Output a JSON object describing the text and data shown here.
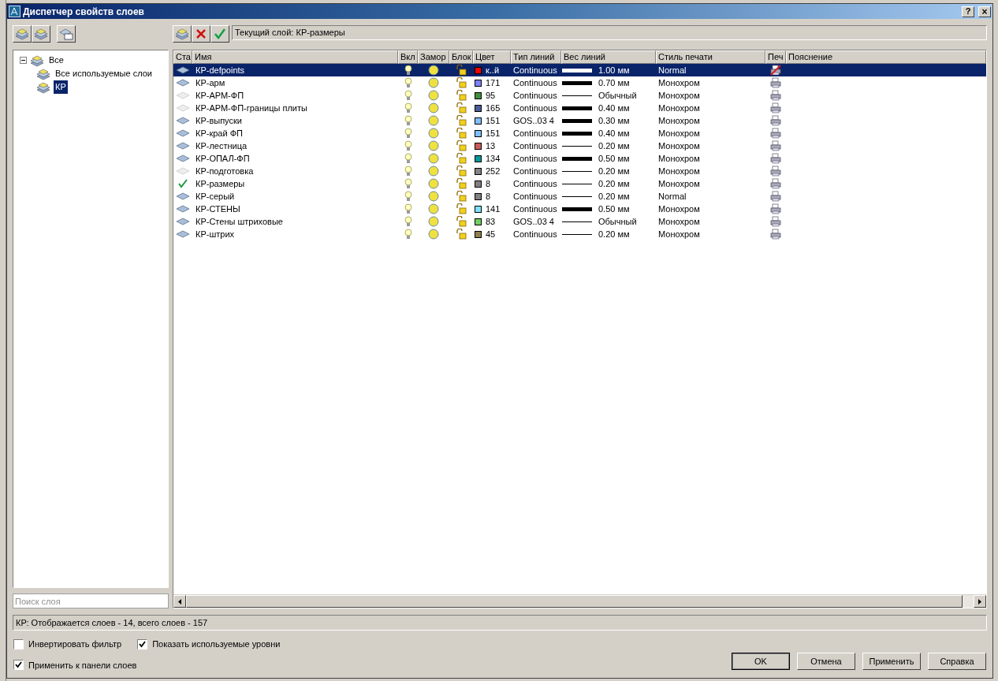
{
  "window": {
    "title": "Диспетчер свойств слоев",
    "help_button": "?",
    "close_button": "×"
  },
  "current_layer": "Текущий слой: КР-размеры",
  "tree": [
    {
      "label": "Все",
      "expanded": true,
      "selected": false,
      "children": [
        {
          "label": "Все используемые слои",
          "selected": false
        },
        {
          "label": "КР",
          "selected": true
        }
      ]
    }
  ],
  "search": {
    "placeholder": "Поиск слоя"
  },
  "table": {
    "columns": [
      "Ста",
      "Имя",
      "Вкл",
      "Замор",
      "Блок",
      "Цвет",
      "Тип линий",
      "Вес линий",
      "Стиль печати",
      "Печ",
      "Пояснение"
    ],
    "rows": [
      {
        "kind": "layer",
        "name": "КР-defpoints",
        "color": "#ff0000",
        "color_label": "к..й",
        "linetype": "Continuous",
        "thick": true,
        "weight": "1.00 мм",
        "plot_style": "Normal",
        "plot": false,
        "selected": true
      },
      {
        "kind": "layer",
        "name": "КР-арм",
        "color": "#8080ff",
        "color_label": "171",
        "linetype": "Continuous",
        "thick": true,
        "weight": "0.70 мм",
        "plot_style": "Монохром",
        "plot": true,
        "selected": false
      },
      {
        "kind": "empty",
        "name": "КР-АРМ-ФП",
        "color": "#3f8f3f",
        "color_label": "95",
        "linetype": "Continuous",
        "thick": false,
        "weight": "Обычный",
        "plot_style": "Монохром",
        "plot": true,
        "selected": false
      },
      {
        "kind": "empty",
        "name": "КР-АРМ-ФП-границы плиты",
        "color": "#4c5c99",
        "color_label": "165",
        "linetype": "Continuous",
        "thick": true,
        "weight": "0.40 мм",
        "plot_style": "Монохром",
        "plot": true,
        "selected": false
      },
      {
        "kind": "layer",
        "name": "КР-выпуски",
        "color": "#7fbfff",
        "color_label": "151",
        "linetype": "GOS..03 4",
        "thick": true,
        "weight": "0.30 мм",
        "plot_style": "Монохром",
        "plot": true,
        "selected": false
      },
      {
        "kind": "layer",
        "name": "КР-край ФП",
        "color": "#7fbfff",
        "color_label": "151",
        "linetype": "Continuous",
        "thick": true,
        "weight": "0.40 мм",
        "plot_style": "Монохром",
        "plot": true,
        "selected": false
      },
      {
        "kind": "layer",
        "name": "КР-лестница",
        "color": "#cc5a5a",
        "color_label": "13",
        "linetype": "Continuous",
        "thick": false,
        "weight": "0.20 мм",
        "plot_style": "Монохром",
        "plot": true,
        "selected": false
      },
      {
        "kind": "layer",
        "name": "КР-ОПАЛ-ФП",
        "color": "#009999",
        "color_label": "134",
        "linetype": "Continuous",
        "thick": true,
        "weight": "0.50 мм",
        "plot_style": "Монохром",
        "plot": true,
        "selected": false
      },
      {
        "kind": "empty",
        "name": "КР-подготовка",
        "color": "#848484",
        "color_label": "252",
        "linetype": "Continuous",
        "thick": false,
        "weight": "0.20 мм",
        "plot_style": "Монохром",
        "plot": true,
        "selected": false
      },
      {
        "kind": "current",
        "name": "КР-размеры",
        "color": "#808080",
        "color_label": "8",
        "linetype": "Continuous",
        "thick": false,
        "weight": "0.20 мм",
        "plot_style": "Монохром",
        "plot": true,
        "selected": false
      },
      {
        "kind": "layer",
        "name": "КР-серый",
        "color": "#808080",
        "color_label": "8",
        "linetype": "Continuous",
        "thick": false,
        "weight": "0.20 мм",
        "plot_style": "Normal",
        "plot": true,
        "selected": false
      },
      {
        "kind": "layer",
        "name": "КР-СТЕНЫ",
        "color": "#7fdfff",
        "color_label": "141",
        "linetype": "Continuous",
        "thick": true,
        "weight": "0.50 мм",
        "plot_style": "Монохром",
        "plot": true,
        "selected": false
      },
      {
        "kind": "layer",
        "name": "КР-Стены штриховые",
        "color": "#6fcf5f",
        "color_label": "83",
        "linetype": "GOS..03 4",
        "thick": false,
        "weight": "Обычный",
        "plot_style": "Монохром",
        "plot": true,
        "selected": false
      },
      {
        "kind": "layer",
        "name": "КР-штрих",
        "color": "#8f7f4f",
        "color_label": "45",
        "linetype": "Continuous",
        "thick": false,
        "weight": "0.20 мм",
        "plot_style": "Монохром",
        "plot": true,
        "selected": false
      }
    ]
  },
  "status_bar": "КР: Отображается слоев - 14, всего слоев - 157",
  "options": [
    {
      "label": "Инвертировать фильтр",
      "checked": false
    },
    {
      "label": "Показать используемые уровни",
      "checked": true
    },
    {
      "label": "Применить к панели слоев",
      "checked": true
    }
  ],
  "buttons": [
    {
      "label": "OK",
      "default": true
    },
    {
      "label": "Отмена",
      "default": false
    },
    {
      "label": "Применить",
      "default": false
    },
    {
      "label": "Справка",
      "default": false
    }
  ]
}
